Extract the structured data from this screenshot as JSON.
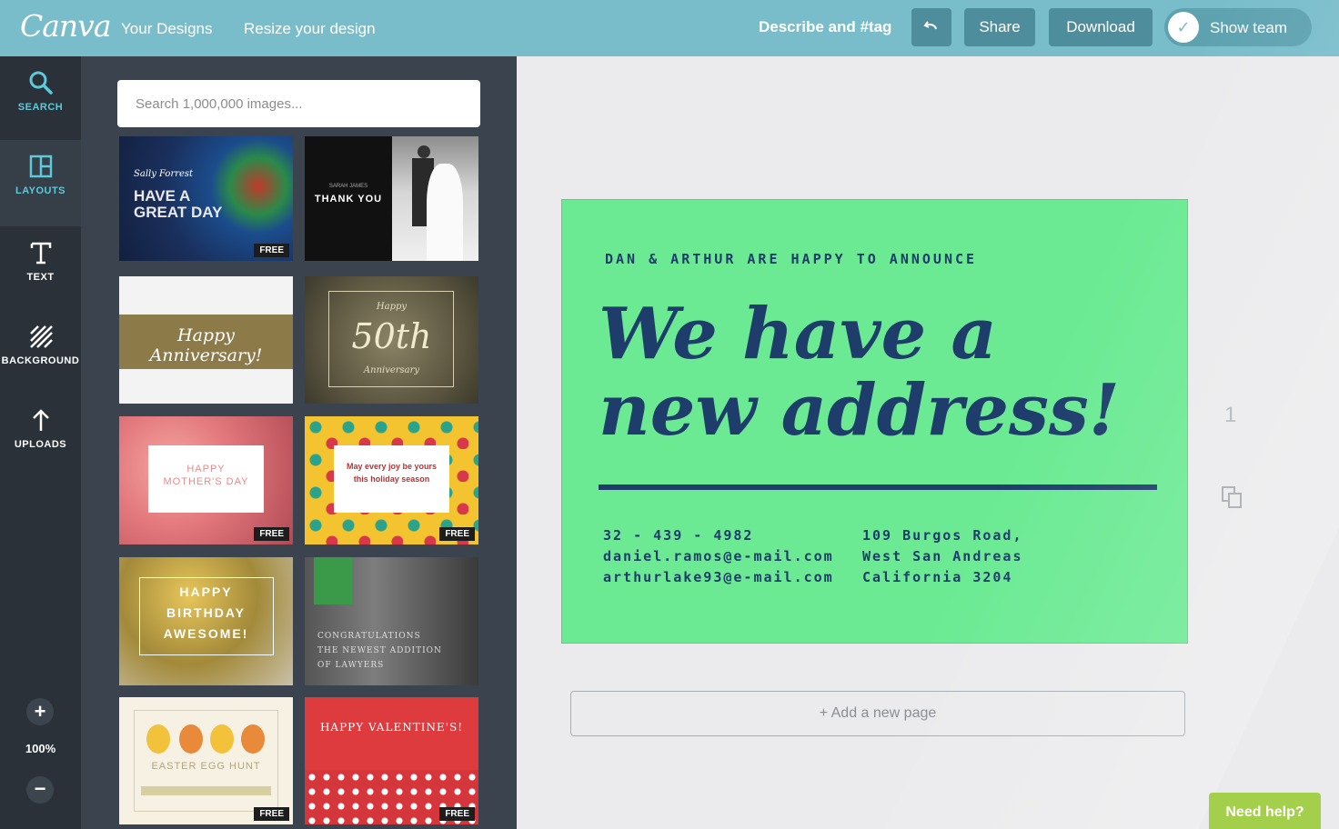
{
  "header": {
    "logo": "Canva",
    "nav": {
      "your_designs": "Your Designs",
      "resize": "Resize your design"
    },
    "describe_tag": "Describe and #tag",
    "undo_icon": "undo-icon",
    "share_label": "Share",
    "download_label": "Download",
    "team_label": "Show team"
  },
  "rail": {
    "search": {
      "label": "SEARCH",
      "icon": "search-icon"
    },
    "layouts": {
      "label": "LAYOUTS",
      "icon": "layouts-icon"
    },
    "text": {
      "label": "TEXT",
      "icon": "text-icon"
    },
    "background": {
      "label": "BACKGROUND",
      "icon": "background-icon"
    },
    "uploads": {
      "label": "UPLOADS",
      "icon": "upload-icon"
    },
    "zoom_in": "+",
    "zoom_level": "100%",
    "zoom_out": "−"
  },
  "panel": {
    "search_placeholder": "Search 1,000,000 images...",
    "badge_free": "FREE",
    "thumbs": {
      "great_day": {
        "small": "Sally Forrest",
        "line1": "HAVE A",
        "line2": "GREAT DAY"
      },
      "thank_you": {
        "small": "SARAH JAMES",
        "title": "THANK YOU"
      },
      "anniversary": {
        "title": "Happy Anniversary!"
      },
      "fiftieth": {
        "top": "Happy",
        "big": "50th",
        "bottom": "Anniversary"
      },
      "mothers_day": {
        "line1": "HAPPY",
        "line2": "MOTHER'S DAY"
      },
      "holiday": {
        "line1": "May every joy be yours",
        "line2": "this holiday season"
      },
      "birthday": {
        "line1": "HAPPY",
        "line2": "BIRTHDAY",
        "line3": "AWESOME!"
      },
      "lawyer": {
        "line1": "CONGRATULATIONS",
        "line2": "THE NEWEST ADDITION",
        "line3": "OF LAWYERS"
      },
      "easter": {
        "title": "EASTER EGG HUNT"
      },
      "valentines": {
        "title": "HAPPY VALENTINE'S!"
      }
    }
  },
  "canvas": {
    "announce": "DAN & ARTHUR ARE HAPPY TO ANNOUNCE",
    "headline_1": "We have a",
    "headline_2": "new address!",
    "contact_left": [
      "32 - 439 - 4982",
      "daniel.ramos@e-mail.com",
      "arthurlake93@e-mail.com"
    ],
    "contact_right": [
      "109 Burgos Road,",
      "West San Andreas",
      "California 3204"
    ],
    "page_number": "1",
    "add_page": "+ Add a new page",
    "need_help": "Need help?"
  },
  "colors": {
    "topbar": "#79bdcb",
    "rail": "#2b3139",
    "panel": "#3b434e",
    "accent": "#5ec9da",
    "card_bg": "#6bea93",
    "card_text": "#1e3d6b",
    "help": "#a4cf4a"
  }
}
